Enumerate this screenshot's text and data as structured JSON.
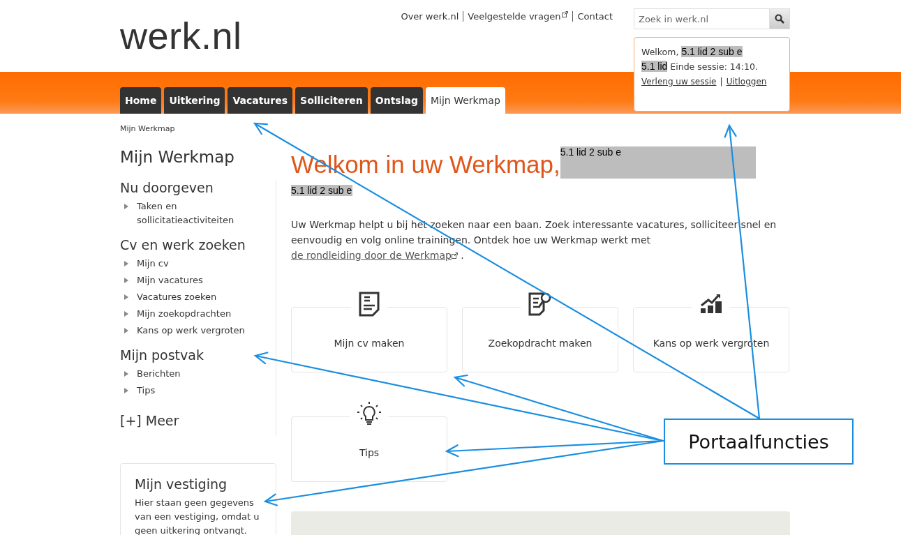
{
  "header": {
    "logo": "werk.nl",
    "top_links": [
      {
        "label": "Over werk.nl",
        "external": false
      },
      {
        "label": "Veelgestelde vragen",
        "external": true
      },
      {
        "label": "Contact",
        "external": false
      }
    ],
    "search": {
      "placeholder": "Zoek in werk.nl"
    },
    "session": {
      "welcome": "Welkom,",
      "redacted_name": "5.1 lid 2 sub e",
      "redacted_short": "5.1 lid",
      "session_end": "Einde sessie: 14:10.",
      "links": [
        "Verleng uw sessie",
        "Uitloggen"
      ],
      "separator": "|"
    }
  },
  "tabs": [
    {
      "label": "Home",
      "selected": false
    },
    {
      "label": "Uitkering",
      "selected": false
    },
    {
      "label": "Vacatures",
      "selected": false
    },
    {
      "label": "Solliciteren",
      "selected": false
    },
    {
      "label": "Ontslag",
      "selected": false
    },
    {
      "label": "Mijn Werkmap",
      "selected": true
    }
  ],
  "breadcrumb": "Mijn Werkmap",
  "sidebar": {
    "title": "Mijn Werkmap",
    "sections": [
      {
        "heading": "Nu doorgeven",
        "items": [
          "Taken en sollicitatieactiviteiten"
        ]
      },
      {
        "heading": "Cv en werk zoeken",
        "items": [
          "Mijn cv",
          "Mijn vacatures",
          "Vacatures zoeken",
          "Mijn zoekopdrachten",
          "Kans op werk vergroten"
        ]
      },
      {
        "heading": "Mijn postvak",
        "items": [
          "Berichten",
          "Tips"
        ]
      }
    ],
    "more": "[+] Meer",
    "branch": {
      "title": "Mijn vestiging",
      "text": "Hier staan geen gegevens van een vestiging, omdat u geen uitkering ontvangt."
    }
  },
  "main": {
    "title": "Welkom in uw Werkmap,",
    "title_redaction": "5.1 lid 2 sub e",
    "sub_redaction": "5.1 lid 2 sub e",
    "intro": {
      "text": "Uw Werkmap helpt u bij het zoeken naar een baan. Zoek interessante vacatures, solliciteer snel en eenvoudig en volg online trainingen. Ontdek hoe uw Werkmap werkt met ",
      "link": "de rondleiding door de Werkmap",
      "after": " ."
    },
    "tiles": [
      {
        "label": "Mijn cv maken",
        "kind": "cv"
      },
      {
        "label": "Zoekopdracht maken",
        "kind": "search"
      },
      {
        "label": "Kans op werk vergroten",
        "kind": "chart"
      },
      {
        "label": "Tips",
        "kind": "bulb"
      }
    ]
  },
  "annotation": {
    "label": "Portaalfuncties"
  }
}
